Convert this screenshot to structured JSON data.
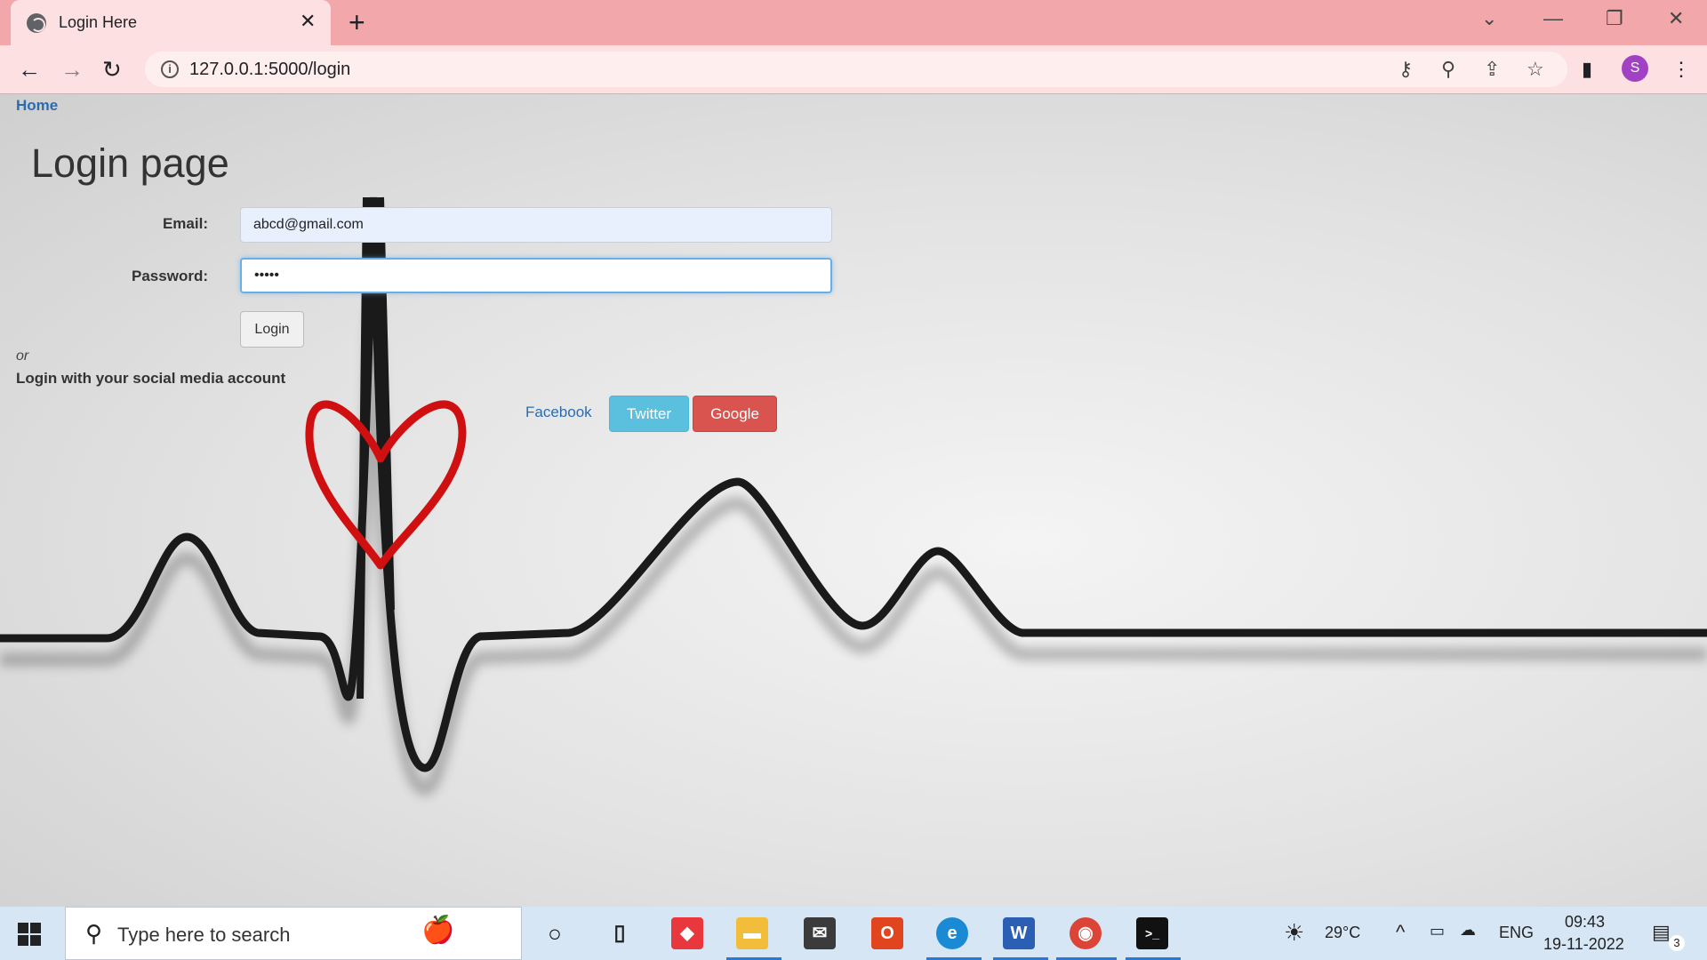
{
  "browser": {
    "tab_title": "Login Here",
    "tab_close": "✕",
    "new_tab": "+",
    "url": "127.0.0.1:5000/login",
    "profile_initial": "S"
  },
  "page": {
    "home_link": "Home",
    "title": "Login page",
    "email_label": "Email:",
    "email_value": "abcd@gmail.com",
    "password_label": "Password:",
    "password_value": "•••••",
    "login_button": "Login",
    "or_text": "or",
    "social_heading": "Login with your social media account",
    "facebook": "Facebook",
    "twitter": "Twitter",
    "google": "Google"
  },
  "taskbar": {
    "search_placeholder": "Type here to search",
    "weather": "29°C",
    "language": "ENG",
    "time": "09:43",
    "date": "19-11-2022",
    "notification_count": "3"
  },
  "colors": {
    "tab_bar": "#f2a8ab",
    "toolbar": "#fde0e1",
    "twitter": "#5bc0de",
    "google": "#d9534f",
    "link": "#2a6cb0"
  }
}
